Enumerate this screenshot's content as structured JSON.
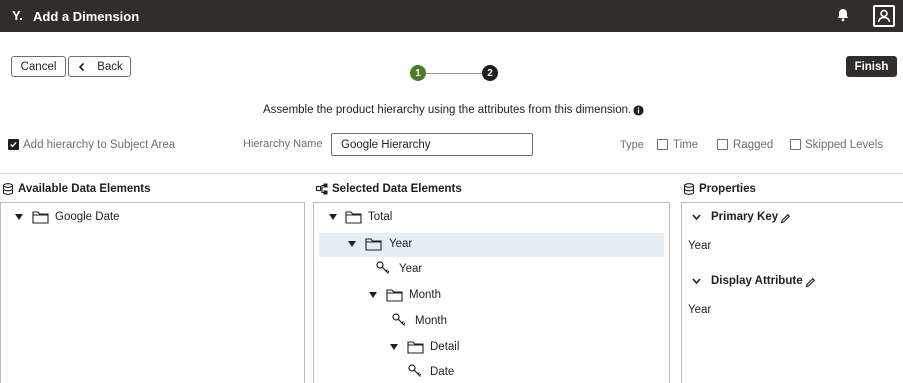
{
  "window": {
    "logo": "Y.",
    "title": "Add a Dimension"
  },
  "icons": {
    "logo": "oracle-analytics-logo",
    "bell": "notification-bell-icon",
    "user": "user-profile-icon",
    "back": "chevron-left-icon",
    "info": "info-icon",
    "database": "database-icon",
    "hierarchy": "hierarchy-icon",
    "folder": "folder-icon",
    "key": "key-icon",
    "caret": "caret-down-icon",
    "chevron": "chevron-down-icon",
    "pencil": "pencil-edit-icon"
  },
  "colors": {
    "topbar": "#312d2a",
    "step_done": "#4f7a28",
    "step_current": "#1f1f1f",
    "selected_row": "#e4eef4"
  },
  "toolbar": {
    "cancel_label": "Cancel",
    "back_label": "Back",
    "finish_label": "Finish"
  },
  "stepper": {
    "steps": [
      "1",
      "2"
    ],
    "current": 2
  },
  "instruction": "Assemble the product hierarchy using the attributes from this dimension.",
  "options": {
    "add_to_subject_area_label": "Add hierarchy to Subject Area",
    "add_to_subject_area_checked": true,
    "hierarchy_name_label": "Hierarchy Name",
    "hierarchy_name_value": "Google Hierarchy",
    "type_label": "Type",
    "type_options": [
      {
        "label": "Time",
        "checked": false
      },
      {
        "label": "Ragged",
        "checked": false
      },
      {
        "label": "Skipped Levels",
        "checked": false
      }
    ]
  },
  "available": {
    "title": "Available Data Elements",
    "items": [
      {
        "label": "Google Date",
        "kind": "folder",
        "expanded": true
      }
    ]
  },
  "selected": {
    "title": "Selected Data Elements",
    "items": [
      {
        "label": "Total",
        "kind": "folder",
        "expanded": true,
        "selected": false
      },
      {
        "label": "Year",
        "kind": "folder",
        "expanded": true,
        "selected": true
      },
      {
        "label": "Year",
        "kind": "key",
        "selected": false
      },
      {
        "label": "Month",
        "kind": "folder",
        "expanded": true,
        "selected": false
      },
      {
        "label": "Month",
        "kind": "key",
        "selected": false
      },
      {
        "label": "Detail",
        "kind": "folder",
        "expanded": true,
        "selected": false
      },
      {
        "label": "Date",
        "kind": "key",
        "selected": false
      }
    ]
  },
  "properties": {
    "title": "Properties",
    "primary_key_label": "Primary Key",
    "primary_key_value": "Year",
    "display_attribute_label": "Display Attribute",
    "display_attribute_value": "Year"
  }
}
